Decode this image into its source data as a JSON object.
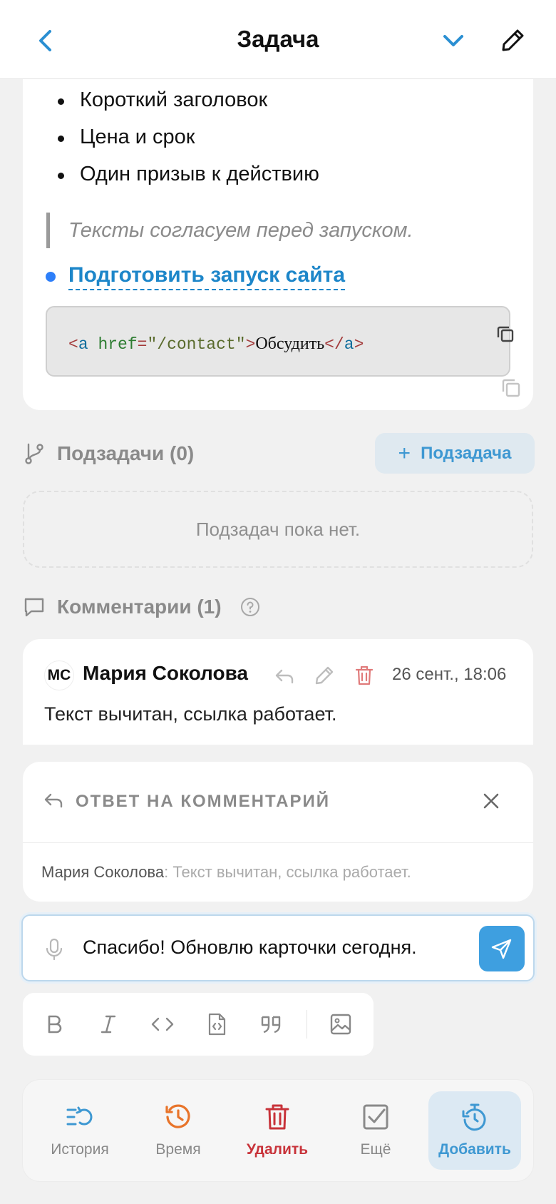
{
  "header": {
    "title": "Задача"
  },
  "description": {
    "bullets": [
      "Короткий заголовок",
      "Цена и срок",
      "Один призыв к действию"
    ],
    "quote": "Тексты согласуем перед запуском.",
    "link_text": "Подготовить запуск сайта",
    "code": {
      "open_lt": "<",
      "tag": "a",
      "attr": "href",
      "eq": "=",
      "value": "\"/contact\"",
      "gt": ">",
      "text": "Обсудить",
      "close_lt": "</",
      "close_tag": "a",
      "close_gt": ">"
    }
  },
  "subtasks": {
    "title": "Подзадачи (0)",
    "add_label": "Подзадача",
    "empty_text": "Подзадач пока нет."
  },
  "comments": {
    "title": "Комментарии (1)",
    "items": [
      {
        "initials": "МС",
        "author": "Мария Соколова",
        "time": "26 сент., 18:06",
        "text": "Текст вычитан, ссылка работает."
      }
    ]
  },
  "reply": {
    "title": "ОТВЕТ НА КОММЕНТАРИЙ",
    "author": "Мария Соколова",
    "sep": ": ",
    "quote": "Текст вычитан, ссылка работает."
  },
  "composer": {
    "value": "Спасибо! Обновлю карточки сегодня."
  },
  "bottom_nav": {
    "history": "История",
    "time": "Время",
    "delete": "Удалить",
    "more": "Ещё",
    "add": "Добавить"
  },
  "colors": {
    "accent": "#3e98d2",
    "danger": "#c8333a",
    "timer": "#e8742a",
    "link": "#1d86c9"
  }
}
